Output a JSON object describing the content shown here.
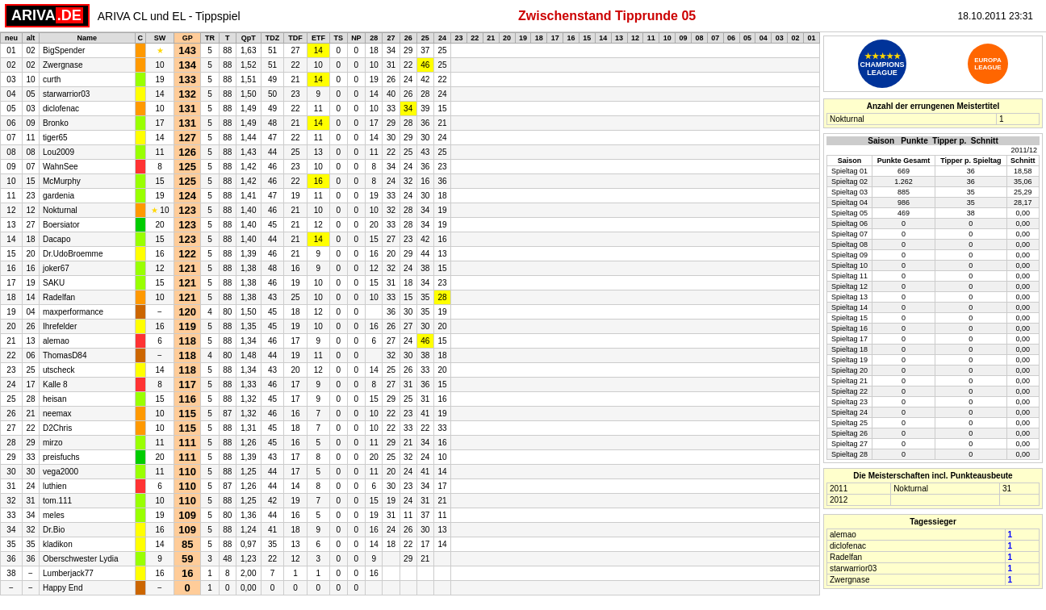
{
  "header": {
    "logo": "ARIVA.DE",
    "title": "ARIVA CL und EL - Tippspiel",
    "main_title": "Zwischenstand Tipprunde 05",
    "date": "18.10.2011 23:31"
  },
  "col_headers": [
    "neu",
    "alt",
    "Name",
    "C",
    "SW",
    "GP",
    "TR",
    "T",
    "QpT",
    "TDZ",
    "TDF",
    "ETF",
    "TS",
    "NP",
    "28",
    "27",
    "26",
    "25",
    "24",
    "23",
    "22",
    "21",
    "20",
    "19",
    "18",
    "17",
    "16",
    "15",
    "14",
    "13",
    "12",
    "11",
    "10",
    "09",
    "08",
    "07",
    "06",
    "05",
    "04",
    "03",
    "02",
    "01"
  ],
  "players": [
    {
      "neu": "01",
      "alt": "02",
      "name": "BigSpender",
      "c_color": "orange",
      "sw": "★",
      "gp": "143",
      "tr": "5",
      "t": "88",
      "qpt": "1,63",
      "tdz": "51",
      "tdf": "27",
      "etf": "14",
      "ts": "0",
      "np": "0",
      "history": [
        18,
        34,
        29,
        37,
        25
      ]
    },
    {
      "neu": "02",
      "alt": "02",
      "name": "Zwergnase",
      "c_color": "orange",
      "sw": "10",
      "gp": "134",
      "tr": "5",
      "t": "88",
      "qpt": "1,52",
      "tdz": "51",
      "tdf": "22",
      "etf": "10",
      "ts": "0",
      "np": "0",
      "history": [
        10,
        31,
        22,
        "46y",
        25
      ]
    },
    {
      "neu": "03",
      "alt": "10",
      "name": "curth",
      "c_color": "lime",
      "sw": "19",
      "gp": "133",
      "tr": "5",
      "t": "88",
      "qpt": "1,51",
      "tdz": "49",
      "tdf": "21",
      "etf": "14",
      "ts": "0",
      "np": "0",
      "history": [
        19,
        26,
        24,
        42,
        22
      ]
    },
    {
      "neu": "04",
      "alt": "05",
      "name": "starwarrior03",
      "c_color": "yellow",
      "sw": "14",
      "gp": "132",
      "tr": "5",
      "t": "88",
      "qpt": "1,50",
      "tdz": "50",
      "tdf": "23",
      "etf": "9",
      "ts": "0",
      "np": "0",
      "history": [
        14,
        40,
        26,
        28,
        24
      ]
    },
    {
      "neu": "05",
      "alt": "03",
      "name": "diclofenac",
      "c_color": "orange",
      "sw": "10",
      "gp": "131",
      "tr": "5",
      "t": "88",
      "qpt": "1,49",
      "tdz": "49",
      "tdf": "22",
      "etf": "11",
      "ts": "0",
      "np": "0",
      "history": [
        10,
        33,
        "34y",
        39,
        15
      ]
    },
    {
      "neu": "06",
      "alt": "09",
      "name": "Bronko",
      "c_color": "lime",
      "sw": "17",
      "gp": "131",
      "tr": "5",
      "t": "88",
      "qpt": "1,49",
      "tdz": "48",
      "tdf": "21",
      "etf": "14",
      "ts": "0",
      "np": "0",
      "history": [
        17,
        29,
        28,
        36,
        21
      ]
    },
    {
      "neu": "07",
      "alt": "11",
      "name": "tiger65",
      "c_color": "yellow",
      "sw": "14",
      "gp": "127",
      "tr": "5",
      "t": "88",
      "qpt": "1,44",
      "tdz": "47",
      "tdf": "22",
      "etf": "11",
      "ts": "0",
      "np": "0",
      "history": [
        14,
        30,
        29,
        30,
        24
      ]
    },
    {
      "neu": "08",
      "alt": "08",
      "name": "Lou2009",
      "c_color": "lime",
      "sw": "11",
      "gp": "126",
      "tr": "5",
      "t": "88",
      "qpt": "1,43",
      "tdz": "44",
      "tdf": "25",
      "etf": "13",
      "ts": "0",
      "np": "0",
      "history": [
        11,
        22,
        25,
        43,
        25
      ]
    },
    {
      "neu": "09",
      "alt": "07",
      "name": "WahnSee",
      "c_color": "red",
      "sw": "8",
      "gp": "125",
      "tr": "5",
      "t": "88",
      "qpt": "1,42",
      "tdz": "46",
      "tdf": "23",
      "etf": "10",
      "ts": "0",
      "np": "0",
      "history": [
        8,
        34,
        24,
        36,
        23
      ]
    },
    {
      "neu": "10",
      "alt": "15",
      "name": "McMurphy",
      "c_color": "lime",
      "sw": "15",
      "gp": "125",
      "tr": "5",
      "t": "88",
      "qpt": "1,42",
      "tdz": "46",
      "tdf": "22",
      "etf": "16",
      "ts": "0",
      "np": "0",
      "history": [
        8,
        24,
        32,
        16,
        36
      ]
    },
    {
      "neu": "11",
      "alt": "23",
      "name": "gardenia",
      "c_color": "lime",
      "sw": "19",
      "gp": "124",
      "tr": "5",
      "t": "88",
      "qpt": "1,41",
      "tdz": "47",
      "tdf": "19",
      "etf": "11",
      "ts": "0",
      "np": "0",
      "history": [
        19,
        33,
        24,
        30,
        18
      ]
    },
    {
      "neu": "12",
      "alt": "12",
      "name": "Nokturnal",
      "c_color": "orange",
      "sw": "★ 10",
      "gp": "123",
      "tr": "5",
      "t": "88",
      "qpt": "1,40",
      "tdz": "46",
      "tdf": "21",
      "etf": "10",
      "ts": "0",
      "np": "0",
      "history": [
        10,
        32,
        28,
        34,
        19
      ]
    },
    {
      "neu": "13",
      "alt": "27",
      "name": "Boersiator",
      "c_color": "green",
      "sw": "20",
      "gp": "123",
      "tr": "5",
      "t": "88",
      "qpt": "1,40",
      "tdz": "45",
      "tdf": "21",
      "etf": "12",
      "ts": "0",
      "np": "0",
      "history": [
        20,
        33,
        28,
        34,
        19
      ]
    },
    {
      "neu": "14",
      "alt": "18",
      "name": "Dacapo",
      "c_color": "lime",
      "sw": "15",
      "gp": "123",
      "tr": "5",
      "t": "88",
      "qpt": "1,40",
      "tdz": "44",
      "tdf": "21",
      "etf": "14",
      "ts": "0",
      "np": "0",
      "history": [
        15,
        27,
        23,
        42,
        16
      ]
    },
    {
      "neu": "15",
      "alt": "20",
      "name": "Dr.UdoBroemme",
      "c_color": "yellow",
      "sw": "16",
      "gp": "122",
      "tr": "5",
      "t": "88",
      "qpt": "1,39",
      "tdz": "46",
      "tdf": "21",
      "etf": "9",
      "ts": "0",
      "np": "0",
      "history": [
        16,
        20,
        29,
        44,
        13
      ]
    },
    {
      "neu": "16",
      "alt": "16",
      "name": "joker67",
      "c_color": "lime",
      "sw": "12",
      "gp": "121",
      "tr": "5",
      "t": "88",
      "qpt": "1,38",
      "tdz": "48",
      "tdf": "16",
      "etf": "9",
      "ts": "0",
      "np": "0",
      "history": [
        12,
        32,
        24,
        38,
        15
      ]
    },
    {
      "neu": "17",
      "alt": "19",
      "name": "SAKU",
      "c_color": "lime",
      "sw": "15",
      "gp": "121",
      "tr": "5",
      "t": "88",
      "qpt": "1,38",
      "tdz": "46",
      "tdf": "19",
      "etf": "10",
      "ts": "0",
      "np": "0",
      "history": [
        15,
        31,
        18,
        34,
        23
      ]
    },
    {
      "neu": "18",
      "alt": "14",
      "name": "Radelfan",
      "c_color": "orange",
      "sw": "10",
      "gp": "121",
      "tr": "5",
      "t": "88",
      "qpt": "1,38",
      "tdz": "43",
      "tdf": "25",
      "etf": "10",
      "ts": "0",
      "np": "0",
      "history": [
        10,
        33,
        15,
        35,
        "28y"
      ]
    },
    {
      "neu": "19",
      "alt": "04",
      "name": "maxperformance",
      "c_color": "brown",
      "sw": "−",
      "gp": "120",
      "tr": "4",
      "t": "80",
      "qpt": "1,50",
      "tdz": "45",
      "tdf": "18",
      "etf": "12",
      "ts": "0",
      "np": "0",
      "history": [
        null,
        36,
        30,
        35,
        19
      ]
    },
    {
      "neu": "20",
      "alt": "26",
      "name": "Ihrefelder",
      "c_color": "yellow",
      "sw": "16",
      "gp": "119",
      "tr": "5",
      "t": "88",
      "qpt": "1,35",
      "tdz": "45",
      "tdf": "19",
      "etf": "10",
      "ts": "0",
      "np": "0",
      "history": [
        16,
        26,
        27,
        30,
        20
      ]
    },
    {
      "neu": "21",
      "alt": "13",
      "name": "alemao",
      "c_color": "red",
      "sw": "6",
      "gp": "118",
      "tr": "5",
      "t": "88",
      "qpt": "1,34",
      "tdz": "46",
      "tdf": "17",
      "etf": "9",
      "ts": "0",
      "np": "0",
      "history": [
        6,
        27,
        24,
        "46y",
        15
      ]
    },
    {
      "neu": "22",
      "alt": "06",
      "name": "ThomasD84",
      "c_color": "brown",
      "sw": "−",
      "gp": "118",
      "tr": "4",
      "t": "80",
      "qpt": "1,48",
      "tdz": "44",
      "tdf": "19",
      "etf": "11",
      "ts": "0",
      "np": "0",
      "history": [
        null,
        32,
        30,
        38,
        18
      ]
    },
    {
      "neu": "23",
      "alt": "25",
      "name": "utscheck",
      "c_color": "yellow",
      "sw": "14",
      "gp": "118",
      "tr": "5",
      "t": "88",
      "qpt": "1,34",
      "tdz": "43",
      "tdf": "20",
      "etf": "12",
      "ts": "0",
      "np": "0",
      "history": [
        14,
        25,
        26,
        33,
        20
      ]
    },
    {
      "neu": "24",
      "alt": "17",
      "name": "Kalle 8",
      "c_color": "red",
      "sw": "8",
      "gp": "117",
      "tr": "5",
      "t": "88",
      "qpt": "1,33",
      "tdz": "46",
      "tdf": "17",
      "etf": "9",
      "ts": "0",
      "np": "0",
      "history": [
        8,
        27,
        31,
        36,
        15
      ]
    },
    {
      "neu": "25",
      "alt": "28",
      "name": "heisan",
      "c_color": "lime",
      "sw": "15",
      "gp": "116",
      "tr": "5",
      "t": "88",
      "qpt": "1,32",
      "tdz": "45",
      "tdf": "17",
      "etf": "9",
      "ts": "0",
      "np": "0",
      "history": [
        15,
        29,
        25,
        31,
        16
      ]
    },
    {
      "neu": "26",
      "alt": "21",
      "name": "neemax",
      "c_color": "orange",
      "sw": "10",
      "gp": "115",
      "tr": "5",
      "t": "87",
      "qpt": "1,32",
      "tdz": "46",
      "tdf": "16",
      "etf": "7",
      "ts": "0",
      "np": "0",
      "history": [
        10,
        22,
        23,
        41,
        19
      ]
    },
    {
      "neu": "27",
      "alt": "22",
      "name": "D2Chris",
      "c_color": "orange",
      "sw": "10",
      "gp": "115",
      "tr": "5",
      "t": "88",
      "qpt": "1,31",
      "tdz": "45",
      "tdf": "18",
      "etf": "7",
      "ts": "0",
      "np": "0",
      "history": [
        10,
        22,
        33,
        22,
        33
      ]
    },
    {
      "neu": "28",
      "alt": "29",
      "name": "mirzo",
      "c_color": "lime",
      "sw": "11",
      "gp": "111",
      "tr": "5",
      "t": "88",
      "qpt": "1,26",
      "tdz": "45",
      "tdf": "16",
      "etf": "5",
      "ts": "0",
      "np": "0",
      "history": [
        11,
        29,
        21,
        34,
        16
      ]
    },
    {
      "neu": "29",
      "alt": "33",
      "name": "preisfuchs",
      "c_color": "green",
      "sw": "20",
      "gp": "111",
      "tr": "5",
      "t": "88",
      "qpt": "1,39",
      "tdz": "43",
      "tdf": "17",
      "etf": "8",
      "ts": "0",
      "np": "0",
      "history": [
        20,
        25,
        32,
        24,
        10
      ]
    },
    {
      "neu": "30",
      "alt": "30",
      "name": "vega2000",
      "c_color": "lime",
      "sw": "11",
      "gp": "110",
      "tr": "5",
      "t": "88",
      "qpt": "1,25",
      "tdz": "44",
      "tdf": "17",
      "etf": "5",
      "ts": "0",
      "np": "0",
      "history": [
        11,
        20,
        24,
        41,
        14
      ]
    },
    {
      "neu": "31",
      "alt": "24",
      "name": "luthien",
      "c_color": "red",
      "sw": "6",
      "gp": "110",
      "tr": "5",
      "t": "87",
      "qpt": "1,26",
      "tdz": "44",
      "tdf": "14",
      "etf": "8",
      "ts": "0",
      "np": "0",
      "history": [
        6,
        30,
        23,
        34,
        17
      ]
    },
    {
      "neu": "32",
      "alt": "31",
      "name": "tom.111",
      "c_color": "lime",
      "sw": "10",
      "gp": "110",
      "tr": "5",
      "t": "88",
      "qpt": "1,25",
      "tdz": "42",
      "tdf": "19",
      "etf": "7",
      "ts": "0",
      "np": "0",
      "history": [
        15,
        19,
        24,
        31,
        21
      ]
    },
    {
      "neu": "33",
      "alt": "34",
      "name": "meles",
      "c_color": "lime",
      "sw": "19",
      "gp": "109",
      "tr": "5",
      "t": "80",
      "qpt": "1,36",
      "tdz": "44",
      "tdf": "16",
      "etf": "5",
      "ts": "0",
      "np": "0",
      "history": [
        19,
        31,
        11,
        37,
        11
      ]
    },
    {
      "neu": "34",
      "alt": "32",
      "name": "Dr.Bio",
      "c_color": "yellow",
      "sw": "16",
      "gp": "109",
      "tr": "5",
      "t": "88",
      "qpt": "1,24",
      "tdz": "41",
      "tdf": "18",
      "etf": "9",
      "ts": "0",
      "np": "0",
      "history": [
        16,
        24,
        26,
        30,
        13
      ]
    },
    {
      "neu": "35",
      "alt": "35",
      "name": "kladikon",
      "c_color": "yellow",
      "sw": "14",
      "gp": "85",
      "tr": "5",
      "t": "88",
      "qpt": "0,97",
      "tdz": "35",
      "tdf": "13",
      "etf": "6",
      "ts": "0",
      "np": "0",
      "history": [
        14,
        18,
        22,
        17,
        14
      ]
    },
    {
      "neu": "36",
      "alt": "36",
      "name": "Oberschwester Lydia",
      "c_color": "lime",
      "sw": "9",
      "gp": "59",
      "tr": "3",
      "t": "48",
      "qpt": "1,23",
      "tdz": "22",
      "tdf": "12",
      "etf": "3",
      "ts": "0",
      "np": "0",
      "history": [
        9,
        null,
        29,
        21,
        null
      ]
    },
    {
      "neu": "38",
      "alt": "−",
      "name": "Lumberjack77",
      "c_color": "yellow",
      "sw": "16",
      "gp": "16",
      "tr": "1",
      "t": "8",
      "qpt": "2,00",
      "tdz": "7",
      "tdf": "1",
      "etf": "1",
      "ts": "0",
      "np": "0",
      "history": [
        16,
        null,
        null,
        null,
        null
      ]
    },
    {
      "neu": "−",
      "alt": "−",
      "name": "Happy End",
      "c_color": "brown",
      "sw": "−",
      "gp": "0",
      "tr": "1",
      "t": "0",
      "qpt": "0,00",
      "tdz": "0",
      "tdf": "0",
      "etf": "0",
      "ts": "0",
      "np": "0",
      "history": [
        null,
        null,
        null,
        null,
        null
      ]
    }
  ],
  "spieltage": [
    {
      "label": "Spieltag 01",
      "punkte": "669",
      "tipper": "36",
      "schnitt": "18,58"
    },
    {
      "label": "Spieltag 02",
      "punkte": "1.262",
      "tipper": "36",
      "schnitt": "35,06"
    },
    {
      "label": "Spieltag 03",
      "punkte": "885",
      "tipper": "35",
      "schnitt": "25,29"
    },
    {
      "label": "Spieltag 04",
      "punkte": "986",
      "tipper": "35",
      "schnitt": "28,17"
    },
    {
      "label": "Spieltag 05",
      "punkte": "469",
      "tipper": "38",
      "schnitt": "0,00"
    },
    {
      "label": "Spieltag 06",
      "punkte": "0",
      "tipper": "0",
      "schnitt": "0,00"
    },
    {
      "label": "Spieltag 07",
      "punkte": "0",
      "tipper": "0",
      "schnitt": "0,00"
    },
    {
      "label": "Spieltag 08",
      "punkte": "0",
      "tipper": "0",
      "schnitt": "0,00"
    },
    {
      "label": "Spieltag 09",
      "punkte": "0",
      "tipper": "0",
      "schnitt": "0,00"
    },
    {
      "label": "Spieltag 10",
      "punkte": "0",
      "tipper": "0",
      "schnitt": "0,00"
    },
    {
      "label": "Spieltag 11",
      "punkte": "0",
      "tipper": "0",
      "schnitt": "0,00"
    },
    {
      "label": "Spieltag 12",
      "punkte": "0",
      "tipper": "0",
      "schnitt": "0,00"
    },
    {
      "label": "Spieltag 13",
      "punkte": "0",
      "tipper": "0",
      "schnitt": "0,00"
    },
    {
      "label": "Spieltag 14",
      "punkte": "0",
      "tipper": "0",
      "schnitt": "0,00"
    },
    {
      "label": "Spieltag 15",
      "punkte": "0",
      "tipper": "0",
      "schnitt": "0,00"
    },
    {
      "label": "Spieltag 16",
      "punkte": "0",
      "tipper": "0",
      "schnitt": "0,00"
    },
    {
      "label": "Spieltag 17",
      "punkte": "0",
      "tipper": "0",
      "schnitt": "0,00"
    },
    {
      "label": "Spieltag 18",
      "punkte": "0",
      "tipper": "0",
      "schnitt": "0,00"
    },
    {
      "label": "Spieltag 19",
      "punkte": "0",
      "tipper": "0",
      "schnitt": "0,00"
    },
    {
      "label": "Spieltag 20",
      "punkte": "0",
      "tipper": "0",
      "schnitt": "0,00"
    },
    {
      "label": "Spieltag 21",
      "punkte": "0",
      "tipper": "0",
      "schnitt": "0,00"
    },
    {
      "label": "Spieltag 22",
      "punkte": "0",
      "tipper": "0",
      "schnitt": "0,00"
    },
    {
      "label": "Spieltag 23",
      "punkte": "0",
      "tipper": "0",
      "schnitt": "0,00"
    },
    {
      "label": "Spieltag 24",
      "punkte": "0",
      "tipper": "0",
      "schnitt": "0,00"
    },
    {
      "label": "Spieltag 25",
      "punkte": "0",
      "tipper": "0",
      "schnitt": "0,00"
    },
    {
      "label": "Spieltag 26",
      "punkte": "0",
      "tipper": "0",
      "schnitt": "0,00"
    },
    {
      "label": "Spieltag 27",
      "punkte": "0",
      "tipper": "0",
      "schnitt": "0,00"
    },
    {
      "label": "Spieltag 28",
      "punkte": "0",
      "tipper": "0",
      "schnitt": "0,00"
    }
  ],
  "meisterschaften": {
    "title": "Anzahl der errungenen Meistertitel",
    "label": "Nokturnal",
    "count": "1",
    "detail_title": "Die Meisterschaften incl. Punkteausbeute",
    "detail_headers": [
      "",
      "",
      ""
    ],
    "detail_rows": [
      {
        "year": "2011",
        "name": "Nokturnal",
        "punkte": "31"
      },
      {
        "year": "2012",
        "name": "",
        "punkte": ""
      }
    ]
  },
  "tagessieger": {
    "title": "Tagessieger",
    "entries": [
      {
        "name": "alemao",
        "count": "1"
      },
      {
        "name": "diclofenac",
        "count": "1"
      },
      {
        "name": "Radelfan",
        "count": "1"
      },
      {
        "name": "starwarrior03",
        "count": "1"
      },
      {
        "name": "Zwergnase",
        "count": "1"
      }
    ]
  },
  "saison_headers": [
    "Saison",
    "Punkte Gesamt",
    "Tipper p. Spieltag",
    "Schnitt"
  ],
  "current_saison": "2011/12"
}
